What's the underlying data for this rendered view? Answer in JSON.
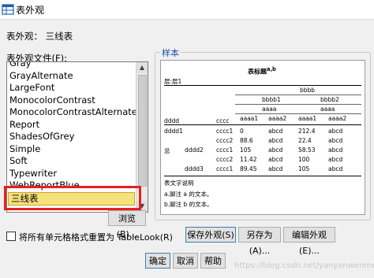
{
  "window": {
    "title": "表外观"
  },
  "current_look_label": "表外观： 三线表",
  "files_label": "表外观文件(F):",
  "list": {
    "items": [
      "Gray",
      "GrayAlternate",
      "LargeFont",
      "MonocolorContrast",
      "MonocolorContrastAlternate",
      "Report",
      "ShadesOfGrey",
      "Simple",
      "Soft",
      "Typewriter",
      "WebReportBlue",
      "三线表"
    ],
    "selected": "三线表"
  },
  "browse_label": "浏览(B)...",
  "sample": {
    "label": "样本",
    "table_title": "表标题",
    "title_sup": "a,b",
    "layer": "层:层1",
    "col_top": "bbbb",
    "col_b1": "bbbb1",
    "col_b2": "bbbb2",
    "col_a_left": "aaaa",
    "col_a_right": "aaaa",
    "col_aaaa1_l": "aaaa1",
    "col_aaaa2_l": "aaaa2",
    "col_aaaa1_r": "aaaa1",
    "col_aaaa2_r": "aaaa2",
    "row_header_d": "dddd",
    "row_header_c": "cccc",
    "rows": [
      {
        "d1": "dddd1",
        "d2": "",
        "c": "cccc1",
        "v1": "0",
        "v2": "abcd",
        "v3": "212.4",
        "v4": "abcd"
      },
      {
        "d1": "",
        "d2": "",
        "c": "cccc2",
        "v1": "88.6",
        "v2": "abcd",
        "v3": "22.4",
        "v4": "abcd"
      },
      {
        "d1": "总",
        "d2": "dddd2",
        "c": "cccc1",
        "v1": "105",
        "v2": "abcd",
        "v3": "58.53",
        "v4": "abcd"
      },
      {
        "d1": "",
        "d2": "",
        "c": "cccc2",
        "v1": "11.42",
        "v2": "abcd",
        "v3": "100",
        "v4": "abcd"
      },
      {
        "d1": "",
        "d2": "dddd3",
        "c": "cccc1",
        "v1": "89.45",
        "v2": "abcd",
        "v3": "105",
        "v4": "abcd"
      }
    ],
    "footnote_title": "表文字说明",
    "footnotes": [
      "a.脚注 a 的文本。",
      "b.脚注 b 的文本。"
    ]
  },
  "reset_checkbox_label": "将所有单元格格式重置为 TableLook(R)",
  "buttons": {
    "save_look": "保存外观(S)",
    "save_as": "另存为(A)...",
    "edit_look": "编辑外观(E)...",
    "ok": "确定",
    "cancel": "取消",
    "help": "帮助"
  },
  "watermark": "https://blog.csdn.net/yanyanwenmeng",
  "colors": {
    "highlight": "#e81f1f",
    "selected_bg": "#f6e27a",
    "group_title": "#1a52a8"
  }
}
